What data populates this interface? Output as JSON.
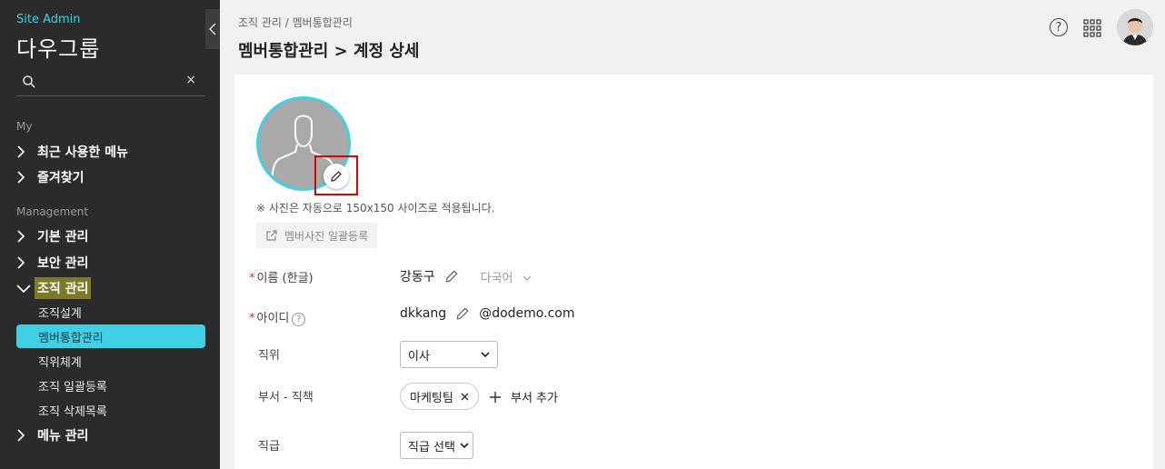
{
  "sidebar": {
    "site_admin": "Site Admin",
    "company": "다우그룹",
    "search_placeholder": "",
    "search_clear": "×",
    "section_my": "My",
    "my_items": [
      {
        "label": "최근 사용한 메뉴"
      },
      {
        "label": "즐겨찾기"
      }
    ],
    "section_management": "Management",
    "mgmt_items": [
      {
        "label": "기본 관리"
      },
      {
        "label": "보안 관리"
      },
      {
        "label": "조직 관리"
      }
    ],
    "org_sub_items": [
      {
        "label": "조직설계"
      },
      {
        "label": "멤버통합관리"
      },
      {
        "label": "직위체계"
      },
      {
        "label": "조직 일괄등록"
      },
      {
        "label": "조직 삭제목록"
      }
    ],
    "menu_mgmt": "메뉴 관리"
  },
  "header": {
    "breadcrumb": "조직 관리 / 멤버통합관리",
    "title": "멤버통합관리 > 계정 상세",
    "help_label": "?"
  },
  "profile": {
    "photo_note": "※ 사진은 자동으로 150x150 사이즈로 적용됩니다.",
    "bulk_photo_label": "멤버사진 일괄등록"
  },
  "form": {
    "name_label": "이름 (한글)",
    "name_value": "강동구",
    "language_label": "다국어",
    "id_label": "아이디",
    "id_value": "dkkang",
    "domain": "@dodemo.com",
    "position_label": "직위",
    "position_value": "이사",
    "dept_label": "부서 - 직책",
    "dept_chip": "마케팅팀",
    "add_dept_label": "부서 추가",
    "grade_label": "직급",
    "grade_value": "직급 선택"
  },
  "colors": {
    "accent": "#3fd0e6",
    "sidebar_bg": "#2b2b2b",
    "active_menu_bg": "#7a7a2a",
    "highlight": "#e00000"
  }
}
